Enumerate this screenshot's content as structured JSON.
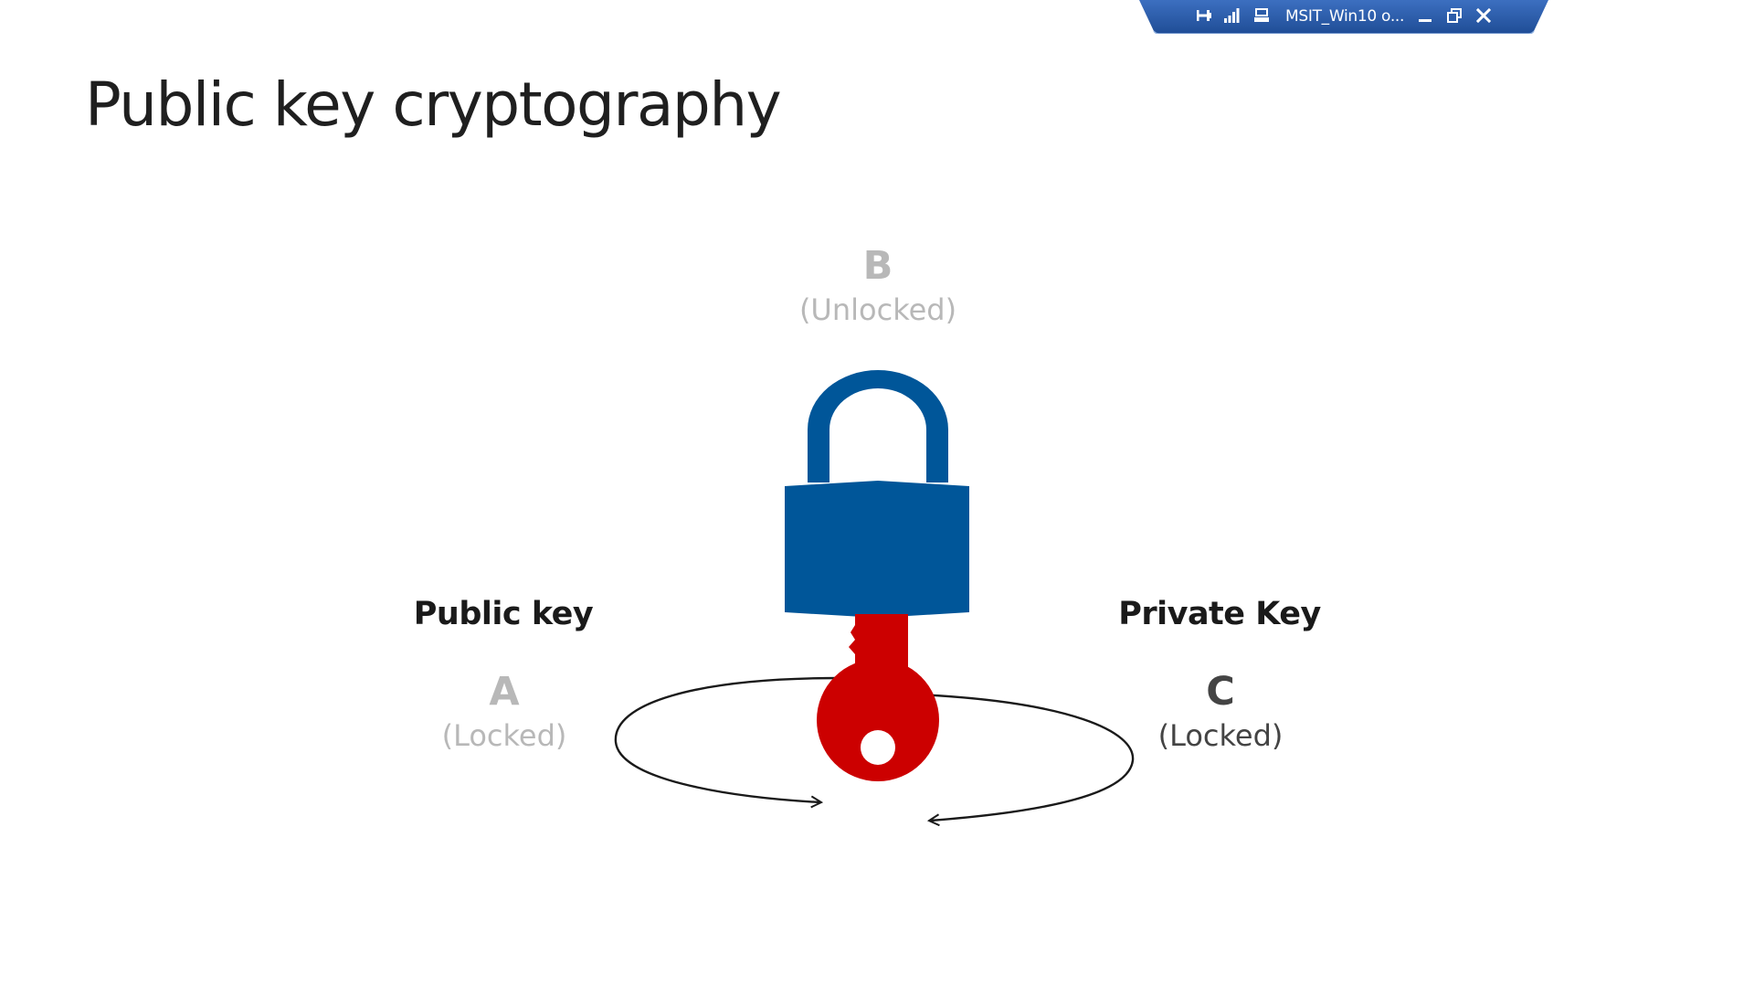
{
  "rdp_bar": {
    "title": "MSIT_Win10 o...",
    "icons": [
      "pin-icon",
      "signal-icon",
      "monitor-icon",
      "minimize-icon",
      "restore-icon",
      "close-icon"
    ],
    "color": "#2b5aa6"
  },
  "slide": {
    "title": "Public key cryptography",
    "state_b": {
      "letter": "B",
      "status": "(Unlocked)"
    },
    "state_a": {
      "letter": "A",
      "status": "(Locked)"
    },
    "state_c": {
      "letter": "C",
      "status": "(Locked)"
    },
    "public_key_label": "Public key",
    "private_key_label": "Private Key"
  },
  "colors": {
    "lock": "#005699",
    "key": "#cc0000",
    "faded_text": "#b8b8b8",
    "dark_text": "#444444"
  }
}
